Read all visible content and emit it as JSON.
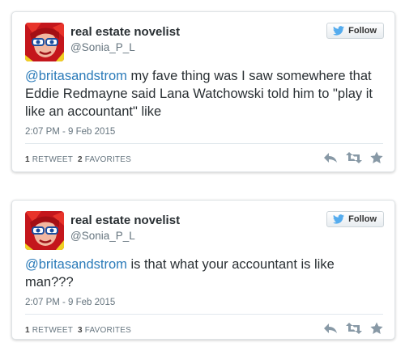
{
  "colors": {
    "link": "#2b7bb9",
    "text": "#292f33",
    "muted": "#66757f",
    "twitter_bird": "#55acee"
  },
  "tweets": [
    {
      "display_name": "real estate novelist",
      "screen_name": "@Sonia_P_L",
      "follow_label": "Follow",
      "mention": "@britasandstrom",
      "text": " my fave thing was I saw somewhere that Eddie Redmayne said Lana Watchowski told him to \"play it like an accountant\" like",
      "timestamp": "2:07 PM - 9 Feb 2015",
      "retweets_count": "1",
      "retweets_label": "RETWEET",
      "favorites_count": "2",
      "favorites_label": "FAVORITES",
      "icons": [
        "reply-icon",
        "retweet-icon",
        "favorite-icon"
      ]
    },
    {
      "display_name": "real estate novelist",
      "screen_name": "@Sonia_P_L",
      "follow_label": "Follow",
      "mention": "@britasandstrom",
      "text": " is that what your accountant is like man???",
      "timestamp": "2:07 PM - 9 Feb 2015",
      "retweets_count": "1",
      "retweets_label": "RETWEET",
      "favorites_count": "3",
      "favorites_label": "FAVORITES",
      "icons": [
        "reply-icon",
        "retweet-icon",
        "favorite-icon"
      ]
    }
  ]
}
